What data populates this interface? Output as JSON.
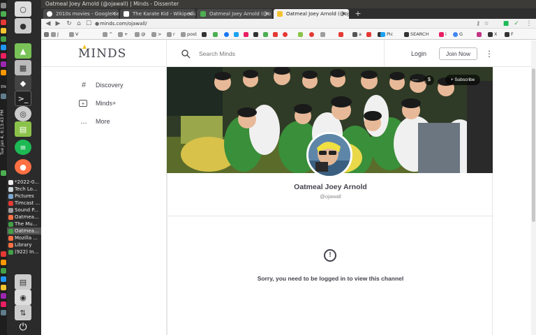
{
  "os": {
    "clock": "Tue Jan 4, 6:13:43 PM",
    "panel_lang": "EN",
    "taskbar": [
      {
        "label": "*2022-0...",
        "color": "#f0f0f0"
      },
      {
        "label": "Tech Lo...",
        "color": "#cfd8dc"
      },
      {
        "label": "Pictures",
        "color": "#7aa7d1"
      },
      {
        "label": "Timcast ...",
        "color": "#e53935"
      },
      {
        "label": "Sound P...",
        "color": "#9e9e9e"
      },
      {
        "label": "Oatmea...",
        "color": "#ff7043"
      },
      {
        "label": "The Mu...",
        "color": "#43a047"
      },
      {
        "label": "Oatmea...",
        "color": "#43a047"
      },
      {
        "label": "Mozilla ...",
        "color": "#ff7043"
      },
      {
        "label": "Library",
        "color": "#ff7043"
      },
      {
        "label": "(922) In...",
        "color": "#43a047"
      }
    ]
  },
  "browser": {
    "window_title": "Oatmeal Joey Arnold (@ojawall) | Minds - Dissenter",
    "tabs": [
      {
        "label": "2010s movies - Google Sea",
        "color": "#ffffff",
        "active": false
      },
      {
        "label": "The Karate Kid - Wikipedia",
        "color": "#ffffff",
        "active": false
      },
      {
        "label": "Oatmeal Joey Arnold (@o",
        "color": "#4caf50",
        "active": false
      },
      {
        "label": "Oatmeal Joey Arnold (@oj",
        "color": "#f4c430",
        "active": true
      }
    ],
    "new_tab": "+",
    "url": "minds.com/ojawall/",
    "bookmarks": [
      "J",
      "V",
      "^",
      "+",
      "@",
      ">",
      "r",
      "post",
      "a",
      "Pic",
      "SEARCH",
      "i",
      "G",
      "X",
      "F"
    ]
  },
  "minds": {
    "logo": "MINDS",
    "search_placeholder": "Search Minds",
    "login": "Login",
    "join_now": "Join Now",
    "sidebar": [
      {
        "icon": "#",
        "label": "Discovery"
      },
      {
        "icon": "+",
        "label": "Minds+"
      },
      {
        "icon": "...",
        "label": "More"
      }
    ],
    "banner": {
      "tip_label": "$",
      "subscribe_label": "+ Subscribe",
      "more_label": "..."
    },
    "channel": {
      "name": "Oatmeal Joey Arnold",
      "handle": "@ojawall",
      "alert_icon": "!",
      "login_message": "Sorry, you need to be logged in to view this channel"
    }
  }
}
